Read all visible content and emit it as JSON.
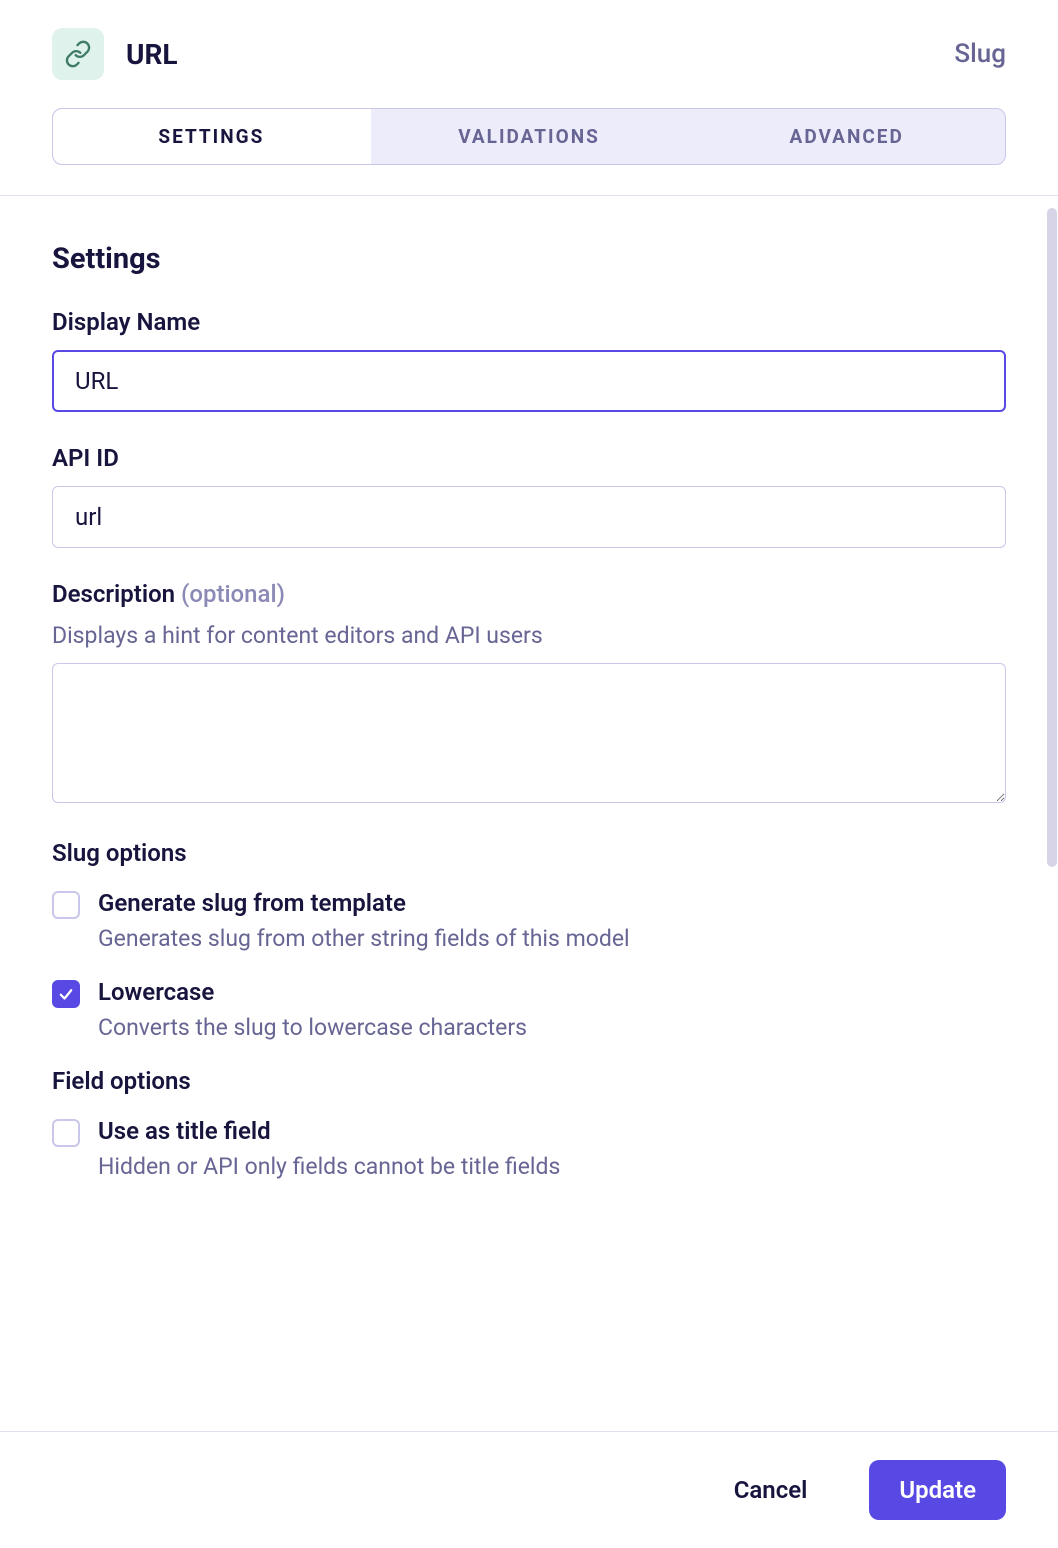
{
  "header": {
    "icon": "link-icon",
    "field_title": "URL",
    "field_type": "Slug"
  },
  "tabs": [
    {
      "label": "Settings",
      "active": true
    },
    {
      "label": "Validations",
      "active": false
    },
    {
      "label": "Advanced",
      "active": false
    }
  ],
  "settings": {
    "section_title": "Settings",
    "display_name": {
      "label": "Display Name",
      "value": "URL"
    },
    "api_id": {
      "label": "API ID",
      "value": "url"
    },
    "description": {
      "label": "Description",
      "optional_tag": "(optional)",
      "hint": "Displays a hint for content editors and API users",
      "value": ""
    },
    "slug_options": {
      "title": "Slug options",
      "items": [
        {
          "key": "generate-from-template",
          "label": "Generate slug from template",
          "hint": "Generates slug from other string fields of this model",
          "checked": false
        },
        {
          "key": "lowercase",
          "label": "Lowercase",
          "hint": "Converts the slug to lowercase characters",
          "checked": true
        }
      ]
    },
    "field_options": {
      "title": "Field options",
      "items": [
        {
          "key": "use-as-title",
          "label": "Use as title field",
          "hint": "Hidden or API only fields cannot be title fields",
          "checked": false
        }
      ]
    }
  },
  "footer": {
    "cancel": "Cancel",
    "update": "Update"
  }
}
